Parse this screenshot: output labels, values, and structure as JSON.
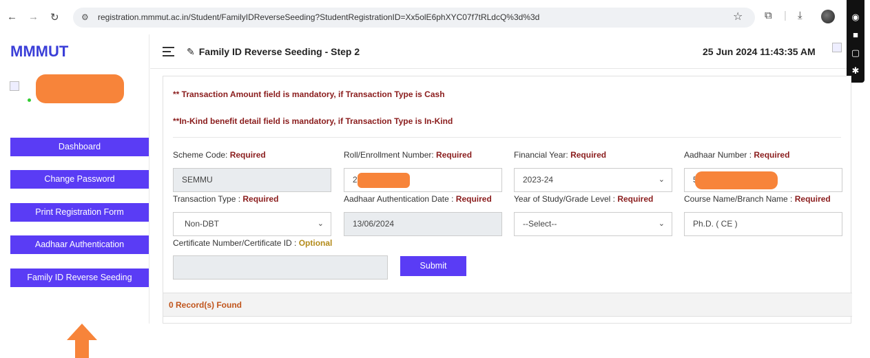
{
  "browser": {
    "url": "registration.mmmut.ac.in/Student/FamilyIDReverseSeeding?StudentRegistrationID=Xx5olE6phXYC07f7tRLdcQ%3d%3d"
  },
  "sidebar": {
    "brand": "MMMUT",
    "menu": [
      {
        "label": "Dashboard"
      },
      {
        "label": "Change Password"
      },
      {
        "label": "Print Registration Form"
      },
      {
        "label": "Aadhaar Authentication"
      },
      {
        "label": "Family ID Reverse Seeding"
      }
    ]
  },
  "header": {
    "title": "Family ID Reverse Seeding - Step 2",
    "datetime": "25 Jun 2024 11:43:35 AM"
  },
  "form": {
    "notice1": "** Transaction Amount field is mandatory, if Transaction Type is Cash",
    "notice2": "**In-Kind benefit detail field is mandatory, if Transaction Type is In-Kind",
    "required_text": "Required",
    "optional_text": "Optional",
    "scheme_code": {
      "label": "Scheme Code: ",
      "value": "SEMMU"
    },
    "roll_number": {
      "label": "Roll/Enrollment Number: ",
      "value": "20"
    },
    "financial_year": {
      "label": "Financial Year: ",
      "value": "2023-24"
    },
    "aadhaar_number": {
      "label": "Aadhaar Number : ",
      "value": "5"
    },
    "transaction_type": {
      "label": "Transaction Type : ",
      "value": "Non-DBT"
    },
    "auth_date": {
      "label": "Aadhaar Authentication Date : ",
      "value": "13/06/2024"
    },
    "year_of_study": {
      "label": "Year of Study/Grade Level : ",
      "value": "--Select--"
    },
    "course_name": {
      "label": "Course Name/Branch Name : ",
      "value": "Ph.D. ( CE )"
    },
    "certificate": {
      "label": "Certificate Number/Certificate ID : ",
      "value": ""
    },
    "submit_label": "Submit",
    "records": "0 Record(s) Found"
  }
}
